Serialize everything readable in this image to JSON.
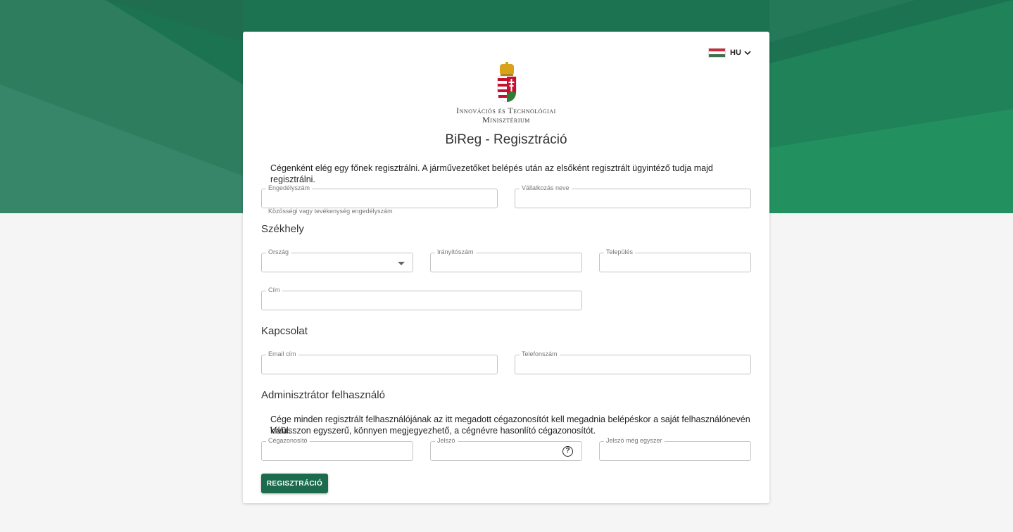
{
  "colors": {
    "hero_green": "#1c7a55",
    "button_green": "#1c6b4c",
    "flag_red": "#cd2a3e",
    "flag_white": "#ffffff",
    "flag_green": "#436f4d"
  },
  "language": {
    "code": "HU",
    "flag_icon": "hungary-flag-icon"
  },
  "ministry": {
    "line1": "Innovációs és Technológiai",
    "line2": "Minisztérium"
  },
  "page_title": "BiReg - Regisztráció",
  "notice_company": "Cégenként elég egy főnek regisztrálni. A járművezetőket belépés után az elsőként regisztrált ügyintéző tudja majd regisztrálni.",
  "fields": {
    "license_number": {
      "label": "Engedélyszám",
      "value": "",
      "helper": "Közösségi vagy tevékenység engedélyszám"
    },
    "company_name": {
      "label": "Vállalkozás neve",
      "value": ""
    },
    "country": {
      "label": "Ország",
      "value": ""
    },
    "postal_code": {
      "label": "Irányítószám",
      "value": ""
    },
    "city": {
      "label": "Település",
      "value": ""
    },
    "address": {
      "label": "Cím",
      "value": ""
    },
    "email": {
      "label": "Email cím",
      "value": ""
    },
    "phone": {
      "label": "Telefonszám",
      "value": ""
    },
    "company_id": {
      "label": "Cégazonosító",
      "value": ""
    },
    "password": {
      "label": "Jelszó",
      "value": ""
    },
    "password_confirm": {
      "label": "Jelszó még egyszer",
      "value": ""
    }
  },
  "sections": {
    "headquarters": "Székhely",
    "contact": "Kapcsolat",
    "admin_user": "Adminisztrátor felhasználó"
  },
  "notice_admin_line1": "Cége minden regisztrált felhasználójának az itt megadott cégazonosítót kell megadnia belépéskor a saját felhasználónevén kívül.",
  "notice_admin_line2": "Válasszon egyszerű, könnyen megjegyezhető, a cégnévre hasonlító cégazonosítót.",
  "register_button": "REGISZTRÁCIÓ"
}
